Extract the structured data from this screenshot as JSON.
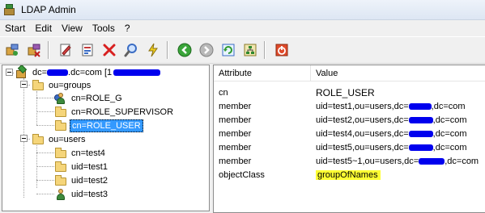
{
  "window": {
    "title": "LDAP Admin"
  },
  "menu": [
    "Start",
    "Edit",
    "View",
    "Tools",
    "?"
  ],
  "toolbar": {
    "buttons": [
      {
        "name": "connect-icon",
        "color": "#c07a1a"
      },
      {
        "name": "disconnect-icon",
        "color": "#8a4a9a"
      },
      {
        "name": "edit-icon",
        "color": "#3a6cc4"
      },
      {
        "name": "new-entry-icon",
        "color": "#c43a3a"
      },
      {
        "name": "delete-icon",
        "color": "#d02020"
      },
      {
        "name": "search-icon",
        "color": "#3a6cc4"
      },
      {
        "name": "flash-icon",
        "color": "#e0c020"
      },
      {
        "name": "back-icon",
        "color": "#2e9a2e"
      },
      {
        "name": "forward-icon",
        "color": "#9a9a9a"
      },
      {
        "name": "refresh-icon",
        "color": "#2e8a9a"
      },
      {
        "name": "schema-icon",
        "color": "#2e8a2e"
      },
      {
        "name": "exit-icon",
        "color": "#d04020"
      }
    ]
  },
  "tree": {
    "root": {
      "label_prefix": "dc=",
      "label_mid": ".dc=com [1"
    },
    "groups": "ou=groups",
    "group_items": [
      "cn=ROLE_G",
      "cn=ROLE_SUPERVISOR",
      "cn=ROLE_USER"
    ],
    "users": "ou=users",
    "user_items": [
      "cn=test4",
      "uid=test1",
      "uid=test2",
      "uid=test3"
    ]
  },
  "attributes": {
    "columns": [
      "Attribute",
      "Value"
    ],
    "rows": [
      {
        "attr": "cn",
        "value": "ROLE_USER"
      },
      {
        "attr": "member",
        "value": "uid=test1,ou=users,dc=",
        "value_end": ",dc=com"
      },
      {
        "attr": "member",
        "value": "uid=test2,ou=users,dc=",
        "value_end": ",dc=com"
      },
      {
        "attr": "member",
        "value": "uid=test4,ou=users,dc=",
        "value_end": ",dc=com"
      },
      {
        "attr": "member",
        "value": "uid=test5,ou=users,dc=",
        "value_end": ",dc=com"
      },
      {
        "attr": "member",
        "value": "uid=test5~1,ou=users,dc=",
        "value_end": ",dc=com"
      },
      {
        "attr": "objectClass",
        "value": "groupOfNames"
      }
    ]
  },
  "colors": {
    "selection": "#3399ff",
    "highlight": "#ffff33",
    "redaction": "#0000ee"
  }
}
